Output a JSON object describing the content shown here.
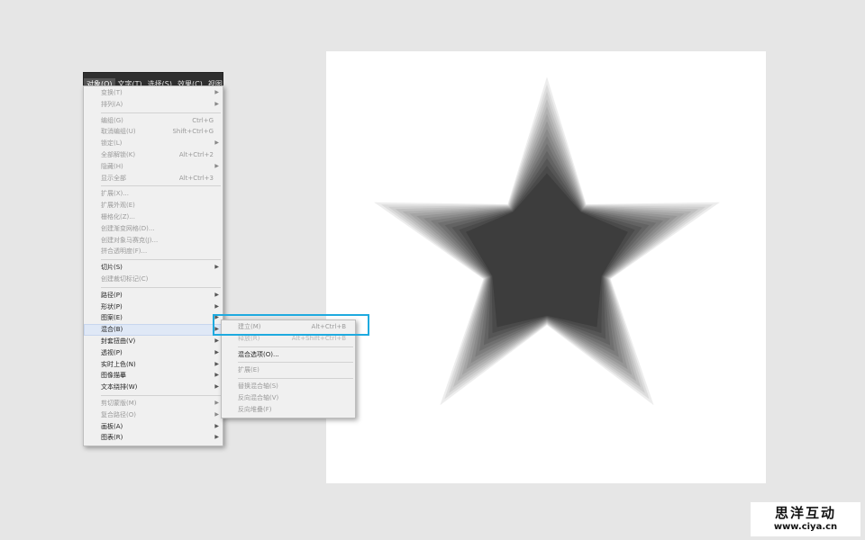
{
  "menubar": {
    "tabs": [
      "对象(O)",
      "文字(T)",
      "选择(S)",
      "效果(C)",
      "视图"
    ]
  },
  "menu": {
    "items": [
      {
        "label": "变换(T)",
        "shortcut": "",
        "submenu": true,
        "enabled": false
      },
      {
        "label": "排列(A)",
        "shortcut": "",
        "submenu": true,
        "enabled": false
      },
      {
        "sep": true
      },
      {
        "label": "编组(G)",
        "shortcut": "Ctrl+G",
        "submenu": false,
        "enabled": false
      },
      {
        "label": "取消编组(U)",
        "shortcut": "Shift+Ctrl+G",
        "submenu": false,
        "enabled": false
      },
      {
        "label": "锁定(L)",
        "shortcut": "",
        "submenu": true,
        "enabled": false
      },
      {
        "label": "全部解锁(K)",
        "shortcut": "Alt+Ctrl+2",
        "submenu": false,
        "enabled": false
      },
      {
        "label": "隐藏(H)",
        "shortcut": "",
        "submenu": true,
        "enabled": false
      },
      {
        "label": "显示全部",
        "shortcut": "Alt+Ctrl+3",
        "submenu": false,
        "enabled": false
      },
      {
        "sep": true
      },
      {
        "label": "扩展(X)...",
        "shortcut": "",
        "submenu": false,
        "enabled": false
      },
      {
        "label": "扩展外观(E)",
        "shortcut": "",
        "submenu": false,
        "enabled": false
      },
      {
        "label": "栅格化(Z)...",
        "shortcut": "",
        "submenu": false,
        "enabled": false
      },
      {
        "label": "创建渐变网格(D)...",
        "shortcut": "",
        "submenu": false,
        "enabled": false
      },
      {
        "label": "创建对象马赛克(J)...",
        "shortcut": "",
        "submenu": false,
        "enabled": false
      },
      {
        "label": "拼合透明度(F)...",
        "shortcut": "",
        "submenu": false,
        "enabled": false
      },
      {
        "sep": true
      },
      {
        "label": "切片(S)",
        "shortcut": "",
        "submenu": true,
        "enabled": true
      },
      {
        "label": "创建裁切标记(C)",
        "shortcut": "",
        "submenu": false,
        "enabled": false
      },
      {
        "sep": true
      },
      {
        "label": "路径(P)",
        "shortcut": "",
        "submenu": true,
        "enabled": true
      },
      {
        "label": "形状(P)",
        "shortcut": "",
        "submenu": true,
        "enabled": true
      },
      {
        "label": "图案(E)",
        "shortcut": "",
        "submenu": true,
        "enabled": true
      },
      {
        "label": "混合(B)",
        "shortcut": "",
        "submenu": true,
        "enabled": true,
        "highlighted": true
      },
      {
        "label": "封套扭曲(V)",
        "shortcut": "",
        "submenu": true,
        "enabled": true
      },
      {
        "label": "透视(P)",
        "shortcut": "",
        "submenu": true,
        "enabled": true
      },
      {
        "label": "实时上色(N)",
        "shortcut": "",
        "submenu": true,
        "enabled": true
      },
      {
        "label": "图像描摹",
        "shortcut": "",
        "submenu": true,
        "enabled": true
      },
      {
        "label": "文本绕排(W)",
        "shortcut": "",
        "submenu": true,
        "enabled": true
      },
      {
        "sep": true
      },
      {
        "label": "剪切蒙版(M)",
        "shortcut": "",
        "submenu": true,
        "enabled": false
      },
      {
        "label": "复合路径(O)",
        "shortcut": "",
        "submenu": true,
        "enabled": false
      },
      {
        "label": "画板(A)",
        "shortcut": "",
        "submenu": true,
        "enabled": true
      },
      {
        "label": "图表(R)",
        "shortcut": "",
        "submenu": true,
        "enabled": true
      }
    ]
  },
  "submenu": {
    "items": [
      {
        "label": "建立(M)",
        "shortcut": "Alt+Ctrl+B",
        "enabled": false
      },
      {
        "label": "释放(R)",
        "shortcut": "Alt+Shift+Ctrl+B",
        "enabled": false,
        "covered": true
      },
      {
        "sep": true
      },
      {
        "label": "混合选项(O)...",
        "shortcut": "",
        "enabled": true
      },
      {
        "sep": true
      },
      {
        "label": "扩展(E)",
        "shortcut": "",
        "enabled": false
      },
      {
        "sep": true
      },
      {
        "label": "替换混合轴(S)",
        "shortcut": "",
        "enabled": false
      },
      {
        "label": "反向混合轴(V)",
        "shortcut": "",
        "enabled": false
      },
      {
        "label": "反向堆叠(F)",
        "shortcut": "",
        "enabled": false
      }
    ]
  },
  "colors": {
    "highlight_box": "#1eaadf",
    "star_center": "#3d3d3d",
    "star_edge": "#ffffff"
  },
  "watermark": {
    "title": "思洋互动",
    "url": "www.ciya.cn"
  }
}
